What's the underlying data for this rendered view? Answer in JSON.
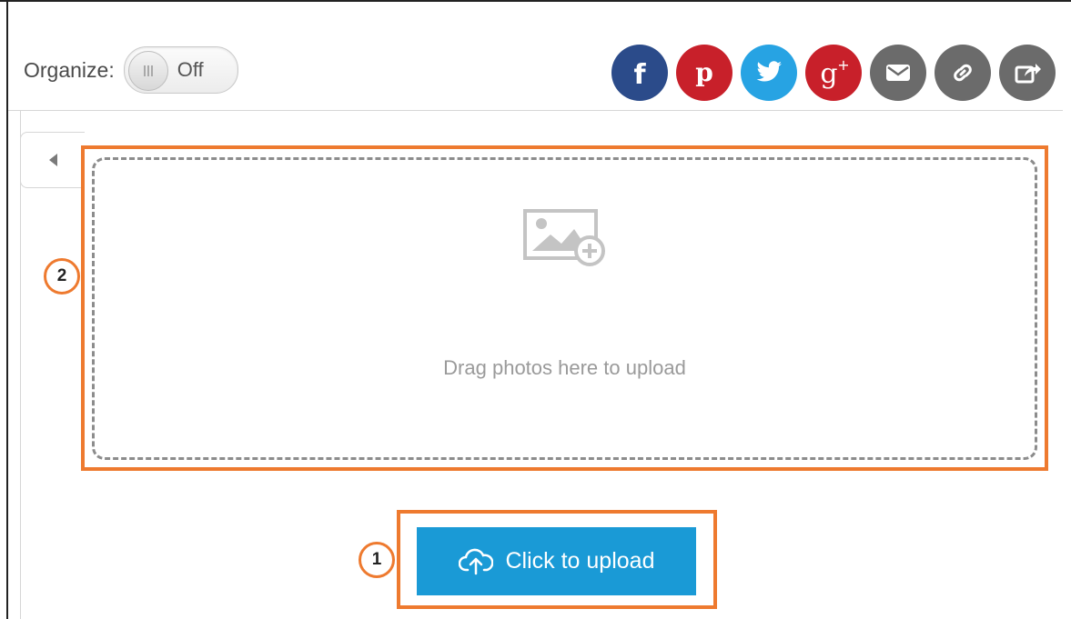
{
  "toolbar": {
    "organize_label": "Organize:",
    "organize_toggle_state": "Off"
  },
  "share_buttons": [
    {
      "name": "facebook",
      "icon": "facebook-icon",
      "color": "#2b4b8a"
    },
    {
      "name": "pinterest",
      "icon": "pinterest-icon",
      "color": "#c8202a"
    },
    {
      "name": "twitter",
      "icon": "twitter-icon",
      "color": "#27a3e3"
    },
    {
      "name": "google-plus",
      "icon": "google-plus-icon",
      "color": "#c8202a"
    },
    {
      "name": "email",
      "icon": "email-icon",
      "color": "#6b6b6b"
    },
    {
      "name": "link",
      "icon": "link-icon",
      "color": "#6b6b6b"
    },
    {
      "name": "share",
      "icon": "share-icon",
      "color": "#6b6b6b"
    }
  ],
  "dropzone": {
    "icon": "add-photo-icon",
    "text": "Drag photos here to upload"
  },
  "upload": {
    "label": "Click to upload",
    "icon": "cloud-upload-icon",
    "color": "#1a9ad6"
  },
  "callouts": {
    "upload_number": "1",
    "dropzone_number": "2",
    "color": "#ee7a2f"
  },
  "panel": {
    "collapse_icon": "caret-left-icon"
  }
}
